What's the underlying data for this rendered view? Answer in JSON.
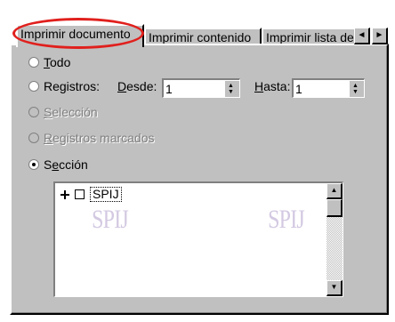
{
  "tabs": [
    {
      "label": "Imprimir documento",
      "active": true
    },
    {
      "label": "Imprimir contenido",
      "active": false
    },
    {
      "label": "Imprimir lista de",
      "active": false
    }
  ],
  "tab_scroll": {
    "left_icon": "◄",
    "right_icon": "►"
  },
  "options": {
    "todo": {
      "label": "Todo",
      "underline": "T",
      "rest": "odo",
      "selected": false,
      "enabled": true
    },
    "registros": {
      "label": "Registros:",
      "selected": false,
      "enabled": true
    },
    "desde": {
      "label": "Desde:",
      "value": "1"
    },
    "hasta": {
      "label": "Hasta:",
      "underline": "H",
      "rest": "asta:",
      "value": "1"
    },
    "seleccion": {
      "label": "Selección",
      "underline": "S",
      "rest": "elección",
      "enabled": false
    },
    "registros_marcados": {
      "label": "Registros marcados",
      "underline": "R",
      "rest": "egistros marcados",
      "enabled": false
    },
    "seccion": {
      "label": "Sección",
      "selected": true,
      "enabled": true
    }
  },
  "tree": {
    "items": [
      {
        "label": "SPIJ",
        "expanded": false,
        "checked": false
      }
    ],
    "watermark_text": "SPIJ"
  },
  "colors": {
    "dialog_bg": "#c0c0c0",
    "highlight": "#e0201d",
    "disabled_text": "#808080"
  }
}
